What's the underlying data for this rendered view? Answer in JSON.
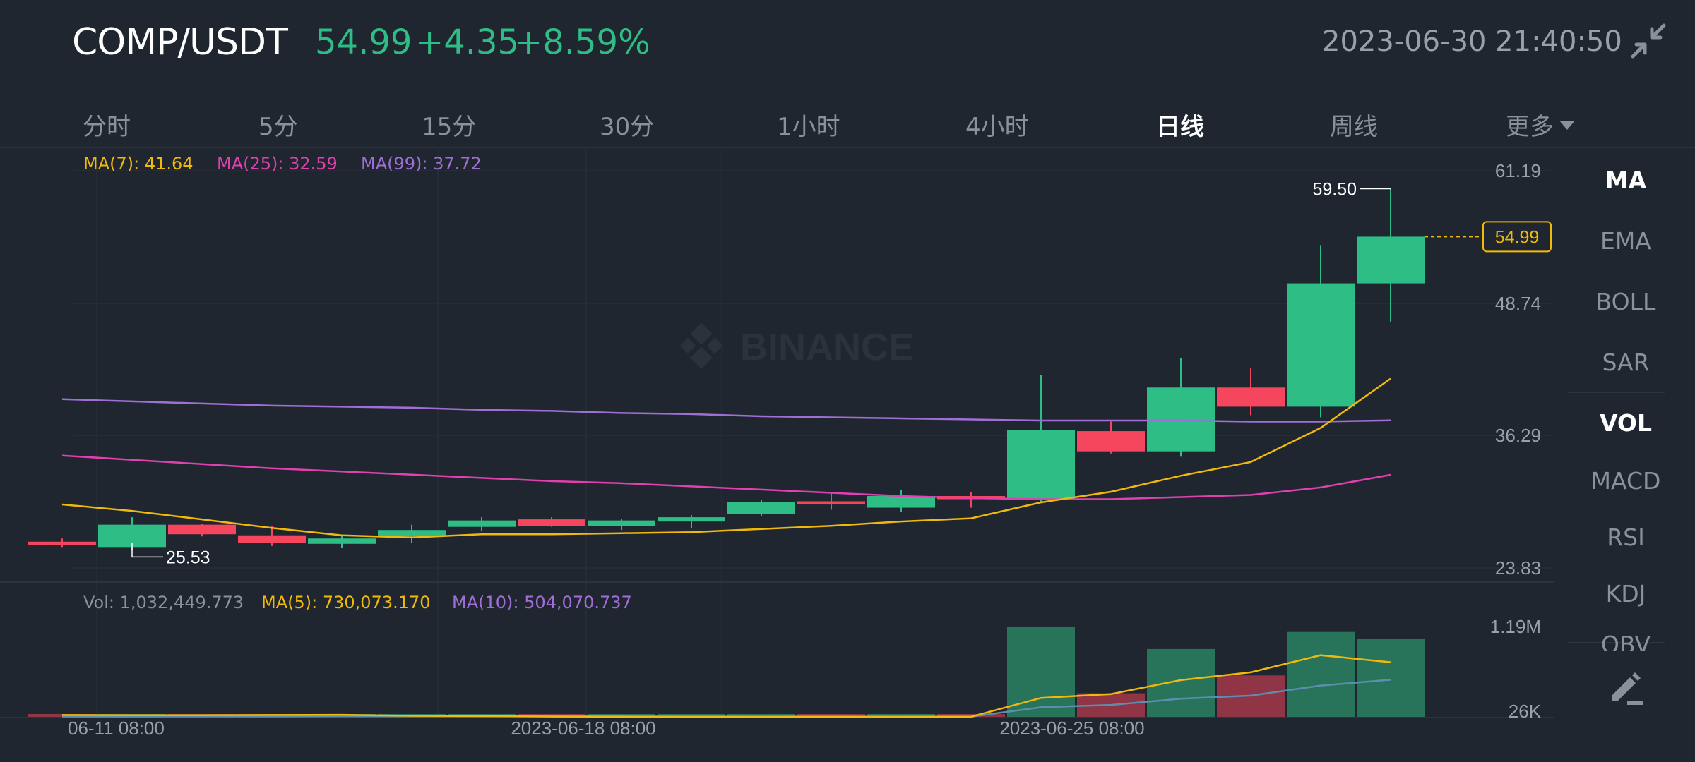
{
  "header": {
    "pair": "COMP/USDT",
    "last_price": "54.99",
    "change": "+4.35",
    "change_pct": "+8.59%",
    "datetime": "2023-06-30 21:40:50",
    "collapse_icon": "collapse-arrows-icon"
  },
  "intervals": [
    {
      "label": "分时",
      "active": false
    },
    {
      "label": "5分",
      "active": false
    },
    {
      "label": "15分",
      "active": false
    },
    {
      "label": "30分",
      "active": false
    },
    {
      "label": "1小时",
      "active": false
    },
    {
      "label": "4小时",
      "active": false
    },
    {
      "label": "日线",
      "active": true
    },
    {
      "label": "周线",
      "active": false
    },
    {
      "label": "更多",
      "active": false
    }
  ],
  "indicators": [
    {
      "label": "MA",
      "active": true
    },
    {
      "label": "EMA",
      "active": false
    },
    {
      "label": "BOLL",
      "active": false
    },
    {
      "label": "SAR",
      "active": false
    },
    {
      "label": "VOL",
      "active": true
    },
    {
      "label": "MACD",
      "active": false
    },
    {
      "label": "RSI",
      "active": false
    },
    {
      "label": "KDJ",
      "active": false
    },
    {
      "label": "OBV",
      "active": false
    }
  ],
  "legend_main": {
    "ma7": "MA(7): 41.64",
    "ma25": "MA(25): 32.59",
    "ma99": "MA(99): 37.72"
  },
  "legend_vol": {
    "vol": "Vol: 1,032,449.773",
    "ma5": "MA(5): 730,073.170",
    "ma10": "MA(10): 504,070.737"
  },
  "watermark": "BINANCE",
  "colors": {
    "up": "#2ebd85",
    "down": "#f6465d",
    "ma7": "#f0b90b",
    "ma25": "#e040b0",
    "ma99": "#9f6fd6",
    "vol_ma10": "#5b8fb0",
    "background": "#1f2630"
  },
  "chart_data": {
    "type": "candlestick",
    "interval": "1d",
    "price_axis_labels": [
      "61.19",
      "48.74",
      "36.29",
      "23.83"
    ],
    "price_range": [
      23.83,
      61.19
    ],
    "volume_axis_labels": [
      "1.19M",
      "26K"
    ],
    "volume_range": [
      26000,
      1190000
    ],
    "date_labels": [
      "06-11 08:00",
      "2023-06-18 08:00",
      "2023-06-25 08:00"
    ],
    "high_label": "59.50",
    "low_label": "25.53",
    "last_price_tag": "54.99",
    "candles": [
      {
        "o": 26.3,
        "h": 26.6,
        "l": 25.8,
        "c": 26.0,
        "v": 30000
      },
      {
        "o": 25.8,
        "h": 28.6,
        "l": 25.53,
        "c": 27.9,
        "v": 40000
      },
      {
        "o": 27.9,
        "h": 28.0,
        "l": 26.8,
        "c": 27.0,
        "v": 45000
      },
      {
        "o": 26.9,
        "h": 27.8,
        "l": 25.9,
        "c": 26.2,
        "v": 42000
      },
      {
        "o": 26.1,
        "h": 26.9,
        "l": 25.7,
        "c": 26.6,
        "v": 28000
      },
      {
        "o": 26.8,
        "h": 27.9,
        "l": 26.2,
        "c": 27.4,
        "v": 26000
      },
      {
        "o": 27.7,
        "h": 28.6,
        "l": 27.3,
        "c": 28.3,
        "v": 27000
      },
      {
        "o": 28.4,
        "h": 28.6,
        "l": 27.7,
        "c": 27.8,
        "v": 25000
      },
      {
        "o": 27.8,
        "h": 28.4,
        "l": 27.4,
        "c": 28.3,
        "v": 24000
      },
      {
        "o": 28.2,
        "h": 28.8,
        "l": 27.6,
        "c": 28.6,
        "v": 26000
      },
      {
        "o": 28.9,
        "h": 30.2,
        "l": 28.7,
        "c": 30.0,
        "v": 28000
      },
      {
        "o": 30.1,
        "h": 31.0,
        "l": 29.3,
        "c": 29.8,
        "v": 27000
      },
      {
        "o": 29.5,
        "h": 31.2,
        "l": 29.1,
        "c": 30.6,
        "v": 29000
      },
      {
        "o": 30.6,
        "h": 31.0,
        "l": 29.5,
        "c": 30.3,
        "v": 30000
      },
      {
        "o": 30.3,
        "h": 42.0,
        "l": 30.0,
        "c": 36.8,
        "v": 1190000
      },
      {
        "o": 36.7,
        "h": 37.6,
        "l": 34.6,
        "c": 34.8,
        "v": 330000
      },
      {
        "o": 34.8,
        "h": 43.6,
        "l": 34.3,
        "c": 40.8,
        "v": 900000
      },
      {
        "o": 40.8,
        "h": 42.6,
        "l": 38.2,
        "c": 39.0,
        "v": 560000
      },
      {
        "o": 39.0,
        "h": 54.2,
        "l": 38.0,
        "c": 50.6,
        "v": 1120000
      },
      {
        "o": 50.6,
        "h": 59.5,
        "l": 47.0,
        "c": 54.99,
        "v": 1032449.773
      }
    ],
    "ma7": [
      29.8,
      29.2,
      28.4,
      27.6,
      26.9,
      26.7,
      27.0,
      27.0,
      27.1,
      27.2,
      27.5,
      27.8,
      28.2,
      28.5,
      30.0,
      31.0,
      32.5,
      33.8,
      37.0,
      41.64
    ],
    "ma25": [
      34.4,
      34.0,
      33.6,
      33.2,
      32.9,
      32.6,
      32.3,
      32.0,
      31.8,
      31.5,
      31.2,
      30.9,
      30.6,
      30.4,
      30.3,
      30.3,
      30.5,
      30.7,
      31.4,
      32.59
    ],
    "ma99": [
      39.7,
      39.5,
      39.3,
      39.1,
      39.0,
      38.9,
      38.7,
      38.6,
      38.4,
      38.3,
      38.1,
      38.0,
      37.9,
      37.8,
      37.7,
      37.7,
      37.7,
      37.6,
      37.6,
      37.72
    ],
    "vol_ma5": [
      50000,
      48000,
      48000,
      50000,
      52000,
      40000,
      35000,
      30000,
      27000,
      26000,
      26000,
      27000,
      27000,
      28000,
      270000,
      320000,
      500000,
      600000,
      820000,
      730073.17
    ],
    "vol_ma10": [
      30000,
      30000,
      31000,
      31000,
      32000,
      33000,
      33000,
      32000,
      32000,
      31000,
      30000,
      30000,
      29000,
      29000,
      150000,
      180000,
      260000,
      300000,
      430000,
      504070.737
    ]
  }
}
